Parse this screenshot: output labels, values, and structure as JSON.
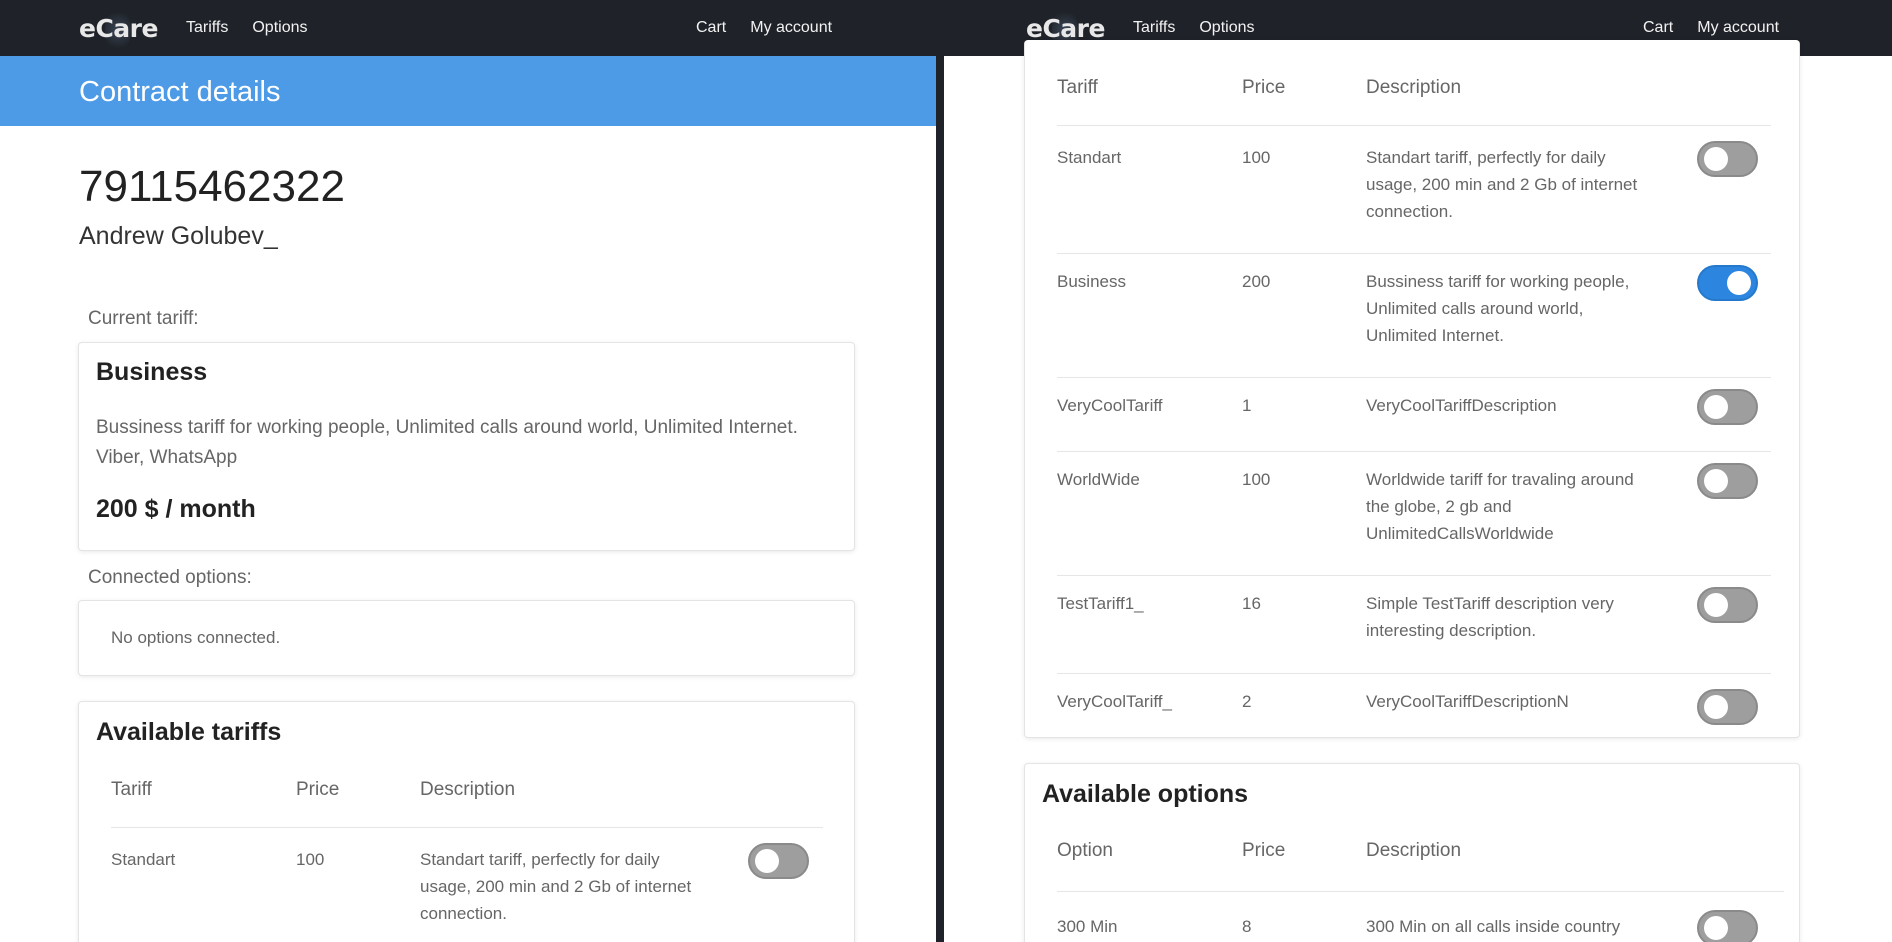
{
  "nav": {
    "brand": "eCare",
    "tariffs": "Tariffs",
    "options": "Options",
    "cart": "Cart",
    "account": "My account"
  },
  "contract": {
    "header": "Contract details",
    "phone": "79115462322",
    "owner": "Andrew Golubev_",
    "current_tariff_label": "Current tariff:",
    "current_tariff": {
      "name": "Business",
      "description": "Bussiness tariff for working people, Unlimited calls around world, Unlimited Internet. Viber, WhatsApp",
      "price": "200 $ / month"
    },
    "connected_options_label": "Connected options:",
    "no_options": "No options connected."
  },
  "available_tariffs": {
    "title": "Available tariffs",
    "headers": {
      "tariff": "Tariff",
      "price": "Price",
      "description": "Description"
    },
    "rows": [
      {
        "name": "Standart",
        "price": "100",
        "description": "Standart tariff, perfectly for daily usage, 200 min and 2 Gb of internet connection.",
        "selected": false
      },
      {
        "name": "Business",
        "price": "200",
        "description": "Bussiness tariff for working people, Unlimited calls around world, Unlimited Internet.",
        "selected": true
      },
      {
        "name": "VeryCoolTariff",
        "price": "1",
        "description": "VeryCoolTariffDescription",
        "selected": false
      },
      {
        "name": "WorldWide",
        "price": "100",
        "description": "Worldwide tariff for travaling around the globe, 2 gb and UnlimitedCallsWorldwide",
        "selected": false
      },
      {
        "name": "TestTariff1_",
        "price": "16",
        "description": "Simple TestTariff description very interesting description.",
        "selected": false
      },
      {
        "name": "VeryCoolTariff_",
        "price": "2",
        "description": "VeryCoolTariffDescriptionN",
        "selected": false
      }
    ]
  },
  "available_options": {
    "title": "Available options",
    "headers": {
      "option": "Option",
      "price": "Price",
      "description": "Description"
    },
    "rows": [
      {
        "name": "300 Min",
        "price": "8",
        "description": "300 Min on all calls inside country",
        "selected": false
      }
    ]
  },
  "colors": {
    "navbar": "#1f2329",
    "header": "#4d9be6",
    "toggle_on": "#2c86e0",
    "toggle_off": "#9e9e9e"
  }
}
